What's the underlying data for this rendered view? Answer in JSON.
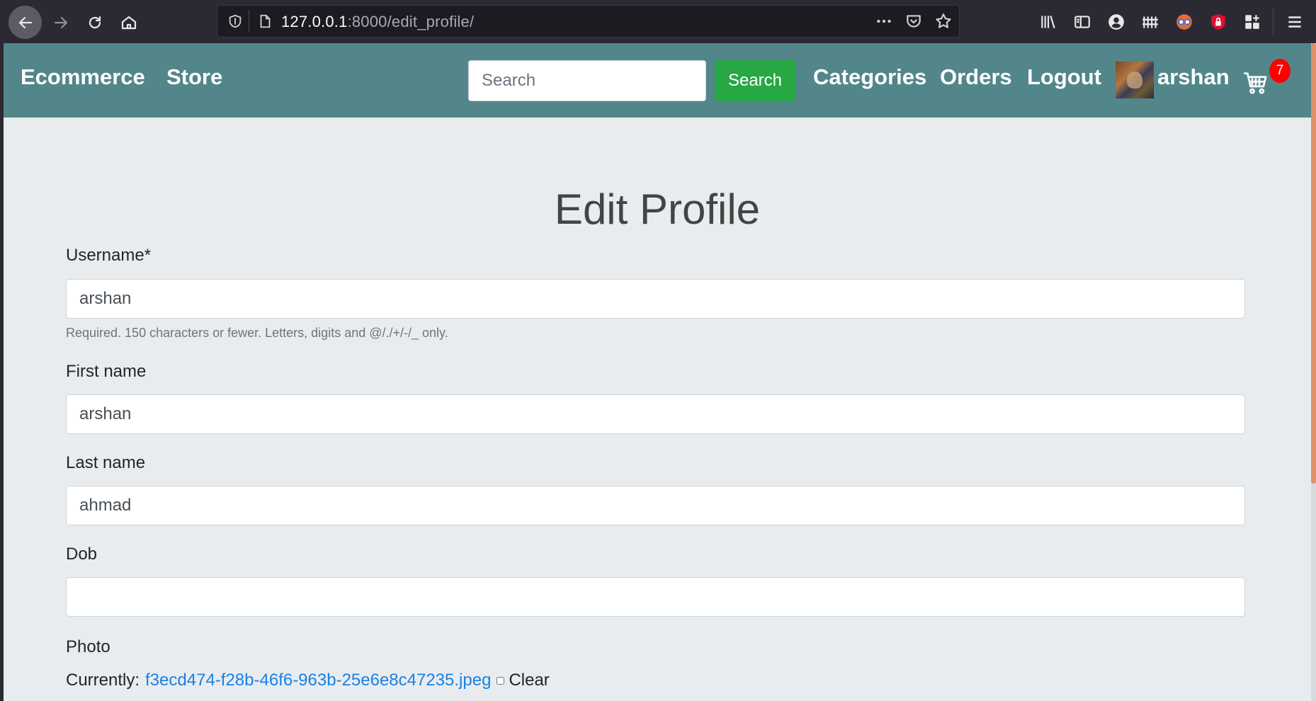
{
  "browser": {
    "url_host": "127.0.0.1",
    "url_path": ":8000/edit_profile/"
  },
  "navbar": {
    "brand": "Ecommerce",
    "store": "Store",
    "search_placeholder": "Search",
    "search_button": "Search",
    "links": [
      "Categories",
      "Orders",
      "Logout"
    ],
    "username": "arshan",
    "cart_count": "7"
  },
  "form": {
    "title": "Edit Profile",
    "username_label": "Username*",
    "username_value": "arshan",
    "username_help": "Required. 150 characters or fewer. Letters, digits and @/./+/-/_ only.",
    "first_name_label": "First name",
    "first_name_value": "arshan",
    "last_name_label": "Last name",
    "last_name_value": "ahmad",
    "dob_label": "Dob",
    "dob_value": "",
    "photo_label": "Photo",
    "photo_currently": "Currently:",
    "photo_file": "f3ecd474-f28b-46f6-963b-25e6e8c47235.jpeg",
    "photo_clear": "Clear"
  },
  "colors": {
    "navbar_bg": "#52868a",
    "search_button_bg": "#28a745",
    "badge_bg": "#ff0000",
    "page_bg": "#e9ecef",
    "link": "#1a80e6"
  }
}
